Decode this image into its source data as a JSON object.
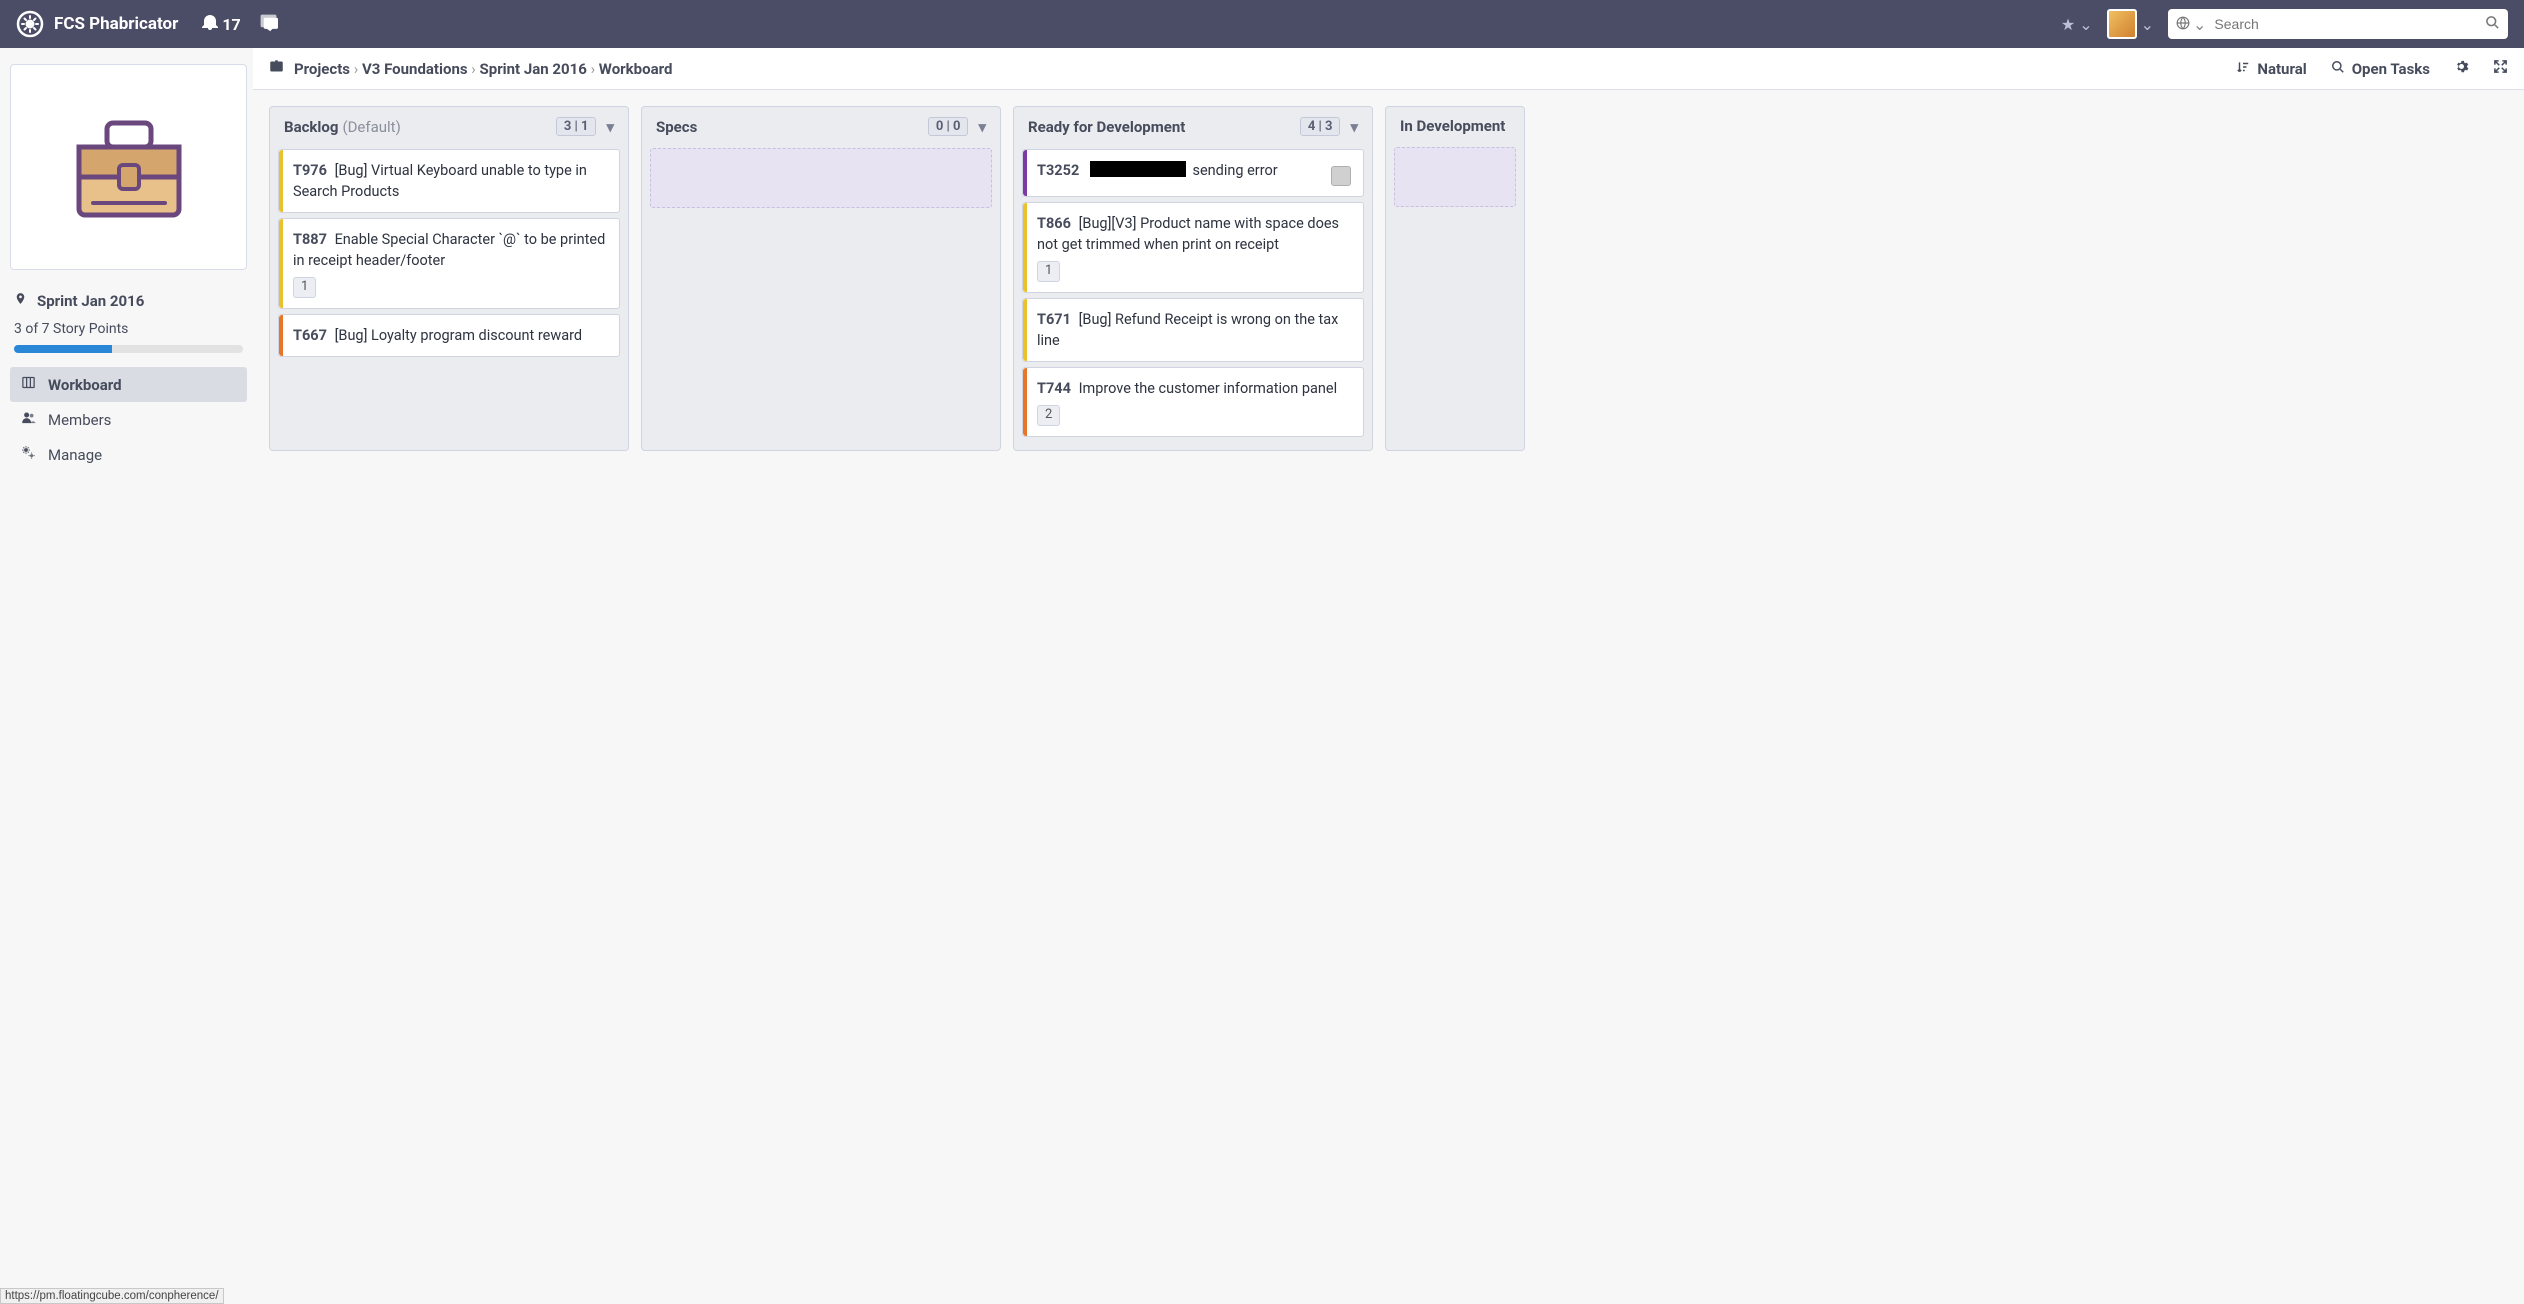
{
  "header": {
    "app_name": "FCS Phabricator",
    "notif_count": "17",
    "search_placeholder": "Search"
  },
  "crumbs": {
    "items": [
      "Projects",
      "V3 Foundations",
      "Sprint Jan 2016",
      "Workboard"
    ],
    "sort_label": "Natural",
    "filter_label": "Open Tasks"
  },
  "sidebar": {
    "sprint_name": "Sprint Jan 2016",
    "story_points": "3 of 7 Story Points",
    "nav": [
      {
        "label": "Workboard",
        "icon": "board",
        "active": true
      },
      {
        "label": "Members",
        "icon": "users",
        "active": false
      },
      {
        "label": "Manage",
        "icon": "cogs",
        "active": false
      }
    ]
  },
  "columns": [
    {
      "title": "Backlog",
      "subtitle": "(Default)",
      "counter": "3 | 1",
      "cards": [
        {
          "id": "T976",
          "title": "[Bug] Virtual Keyboard unable to type in Search Products",
          "color": "yellow"
        },
        {
          "id": "T887",
          "title": "Enable Special Character `@` to be printed in receipt header/footer",
          "color": "yellow",
          "badge": "1"
        },
        {
          "id": "T667",
          "title": "[Bug] Loyalty program discount reward",
          "color": "orange"
        }
      ]
    },
    {
      "title": "Specs",
      "counter": "0 | 0",
      "dropzone": true,
      "cards": []
    },
    {
      "title": "Ready for Development",
      "counter": "4 | 3",
      "cards": [
        {
          "id": "T3252",
          "redact": true,
          "title_after": "sending error",
          "color": "purple",
          "avatar": true
        },
        {
          "id": "T866",
          "title": "[Bug][V3] Product name with space does not get trimmed when print on receipt",
          "color": "yellow",
          "badge": "1"
        },
        {
          "id": "T671",
          "title": "[Bug] Refund Receipt is wrong on the tax line",
          "color": "yellow"
        },
        {
          "id": "T744",
          "title": "Improve the customer information panel",
          "color": "orange",
          "badge": "2"
        }
      ]
    },
    {
      "title": "In Development",
      "partial": true,
      "dropzone": true,
      "cards": []
    }
  ],
  "statusbar": "https://pm.floatingcube.com/conpherence/"
}
